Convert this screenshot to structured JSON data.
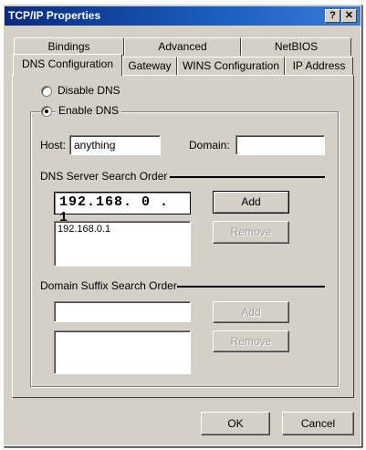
{
  "window": {
    "title": "TCP/IP Properties",
    "help_glyph": "?",
    "close_glyph": "✕"
  },
  "tabs": {
    "row_back": [
      "Bindings",
      "Advanced",
      "NetBIOS"
    ],
    "row_front": [
      "DNS Configuration",
      "Gateway",
      "WINS Configuration",
      "IP Address"
    ],
    "active": "DNS Configuration"
  },
  "dns": {
    "disable_label": "Disable DNS",
    "enable_label": "Enable DNS",
    "selected": "enable",
    "host_label": "Host:",
    "host_value": "anything",
    "domain_label": "Domain:",
    "domain_value": ""
  },
  "server_order": {
    "title": "DNS Server Search Order",
    "ip_value": "192.168. 0 . 1",
    "add_label": "Add",
    "remove_label": "Remove",
    "list": [
      "192.168.0.1"
    ]
  },
  "suffix_order": {
    "title": "Domain Suffix Search Order",
    "input_value": "",
    "add_label": "Add",
    "remove_label": "Remove"
  },
  "footer": {
    "ok_label": "OK",
    "cancel_label": "Cancel"
  }
}
